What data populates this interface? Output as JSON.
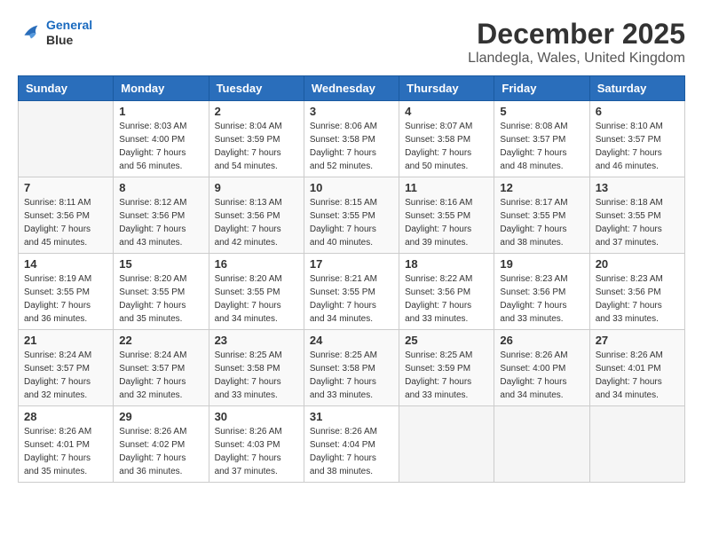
{
  "logo": {
    "line1": "General",
    "line2": "Blue"
  },
  "title": "December 2025",
  "subtitle": "Llandegla, Wales, United Kingdom",
  "weekdays": [
    "Sunday",
    "Monday",
    "Tuesday",
    "Wednesday",
    "Thursday",
    "Friday",
    "Saturday"
  ],
  "weeks": [
    [
      {
        "day": "",
        "sunrise": "",
        "sunset": "",
        "daylight": ""
      },
      {
        "day": "1",
        "sunrise": "Sunrise: 8:03 AM",
        "sunset": "Sunset: 4:00 PM",
        "daylight": "Daylight: 7 hours and 56 minutes."
      },
      {
        "day": "2",
        "sunrise": "Sunrise: 8:04 AM",
        "sunset": "Sunset: 3:59 PM",
        "daylight": "Daylight: 7 hours and 54 minutes."
      },
      {
        "day": "3",
        "sunrise": "Sunrise: 8:06 AM",
        "sunset": "Sunset: 3:58 PM",
        "daylight": "Daylight: 7 hours and 52 minutes."
      },
      {
        "day": "4",
        "sunrise": "Sunrise: 8:07 AM",
        "sunset": "Sunset: 3:58 PM",
        "daylight": "Daylight: 7 hours and 50 minutes."
      },
      {
        "day": "5",
        "sunrise": "Sunrise: 8:08 AM",
        "sunset": "Sunset: 3:57 PM",
        "daylight": "Daylight: 7 hours and 48 minutes."
      },
      {
        "day": "6",
        "sunrise": "Sunrise: 8:10 AM",
        "sunset": "Sunset: 3:57 PM",
        "daylight": "Daylight: 7 hours and 46 minutes."
      }
    ],
    [
      {
        "day": "7",
        "sunrise": "Sunrise: 8:11 AM",
        "sunset": "Sunset: 3:56 PM",
        "daylight": "Daylight: 7 hours and 45 minutes."
      },
      {
        "day": "8",
        "sunrise": "Sunrise: 8:12 AM",
        "sunset": "Sunset: 3:56 PM",
        "daylight": "Daylight: 7 hours and 43 minutes."
      },
      {
        "day": "9",
        "sunrise": "Sunrise: 8:13 AM",
        "sunset": "Sunset: 3:56 PM",
        "daylight": "Daylight: 7 hours and 42 minutes."
      },
      {
        "day": "10",
        "sunrise": "Sunrise: 8:15 AM",
        "sunset": "Sunset: 3:55 PM",
        "daylight": "Daylight: 7 hours and 40 minutes."
      },
      {
        "day": "11",
        "sunrise": "Sunrise: 8:16 AM",
        "sunset": "Sunset: 3:55 PM",
        "daylight": "Daylight: 7 hours and 39 minutes."
      },
      {
        "day": "12",
        "sunrise": "Sunrise: 8:17 AM",
        "sunset": "Sunset: 3:55 PM",
        "daylight": "Daylight: 7 hours and 38 minutes."
      },
      {
        "day": "13",
        "sunrise": "Sunrise: 8:18 AM",
        "sunset": "Sunset: 3:55 PM",
        "daylight": "Daylight: 7 hours and 37 minutes."
      }
    ],
    [
      {
        "day": "14",
        "sunrise": "Sunrise: 8:19 AM",
        "sunset": "Sunset: 3:55 PM",
        "daylight": "Daylight: 7 hours and 36 minutes."
      },
      {
        "day": "15",
        "sunrise": "Sunrise: 8:20 AM",
        "sunset": "Sunset: 3:55 PM",
        "daylight": "Daylight: 7 hours and 35 minutes."
      },
      {
        "day": "16",
        "sunrise": "Sunrise: 8:20 AM",
        "sunset": "Sunset: 3:55 PM",
        "daylight": "Daylight: 7 hours and 34 minutes."
      },
      {
        "day": "17",
        "sunrise": "Sunrise: 8:21 AM",
        "sunset": "Sunset: 3:55 PM",
        "daylight": "Daylight: 7 hours and 34 minutes."
      },
      {
        "day": "18",
        "sunrise": "Sunrise: 8:22 AM",
        "sunset": "Sunset: 3:56 PM",
        "daylight": "Daylight: 7 hours and 33 minutes."
      },
      {
        "day": "19",
        "sunrise": "Sunrise: 8:23 AM",
        "sunset": "Sunset: 3:56 PM",
        "daylight": "Daylight: 7 hours and 33 minutes."
      },
      {
        "day": "20",
        "sunrise": "Sunrise: 8:23 AM",
        "sunset": "Sunset: 3:56 PM",
        "daylight": "Daylight: 7 hours and 33 minutes."
      }
    ],
    [
      {
        "day": "21",
        "sunrise": "Sunrise: 8:24 AM",
        "sunset": "Sunset: 3:57 PM",
        "daylight": "Daylight: 7 hours and 32 minutes."
      },
      {
        "day": "22",
        "sunrise": "Sunrise: 8:24 AM",
        "sunset": "Sunset: 3:57 PM",
        "daylight": "Daylight: 7 hours and 32 minutes."
      },
      {
        "day": "23",
        "sunrise": "Sunrise: 8:25 AM",
        "sunset": "Sunset: 3:58 PM",
        "daylight": "Daylight: 7 hours and 33 minutes."
      },
      {
        "day": "24",
        "sunrise": "Sunrise: 8:25 AM",
        "sunset": "Sunset: 3:58 PM",
        "daylight": "Daylight: 7 hours and 33 minutes."
      },
      {
        "day": "25",
        "sunrise": "Sunrise: 8:25 AM",
        "sunset": "Sunset: 3:59 PM",
        "daylight": "Daylight: 7 hours and 33 minutes."
      },
      {
        "day": "26",
        "sunrise": "Sunrise: 8:26 AM",
        "sunset": "Sunset: 4:00 PM",
        "daylight": "Daylight: 7 hours and 34 minutes."
      },
      {
        "day": "27",
        "sunrise": "Sunrise: 8:26 AM",
        "sunset": "Sunset: 4:01 PM",
        "daylight": "Daylight: 7 hours and 34 minutes."
      }
    ],
    [
      {
        "day": "28",
        "sunrise": "Sunrise: 8:26 AM",
        "sunset": "Sunset: 4:01 PM",
        "daylight": "Daylight: 7 hours and 35 minutes."
      },
      {
        "day": "29",
        "sunrise": "Sunrise: 8:26 AM",
        "sunset": "Sunset: 4:02 PM",
        "daylight": "Daylight: 7 hours and 36 minutes."
      },
      {
        "day": "30",
        "sunrise": "Sunrise: 8:26 AM",
        "sunset": "Sunset: 4:03 PM",
        "daylight": "Daylight: 7 hours and 37 minutes."
      },
      {
        "day": "31",
        "sunrise": "Sunrise: 8:26 AM",
        "sunset": "Sunset: 4:04 PM",
        "daylight": "Daylight: 7 hours and 38 minutes."
      },
      {
        "day": "",
        "sunrise": "",
        "sunset": "",
        "daylight": ""
      },
      {
        "day": "",
        "sunrise": "",
        "sunset": "",
        "daylight": ""
      },
      {
        "day": "",
        "sunrise": "",
        "sunset": "",
        "daylight": ""
      }
    ]
  ]
}
